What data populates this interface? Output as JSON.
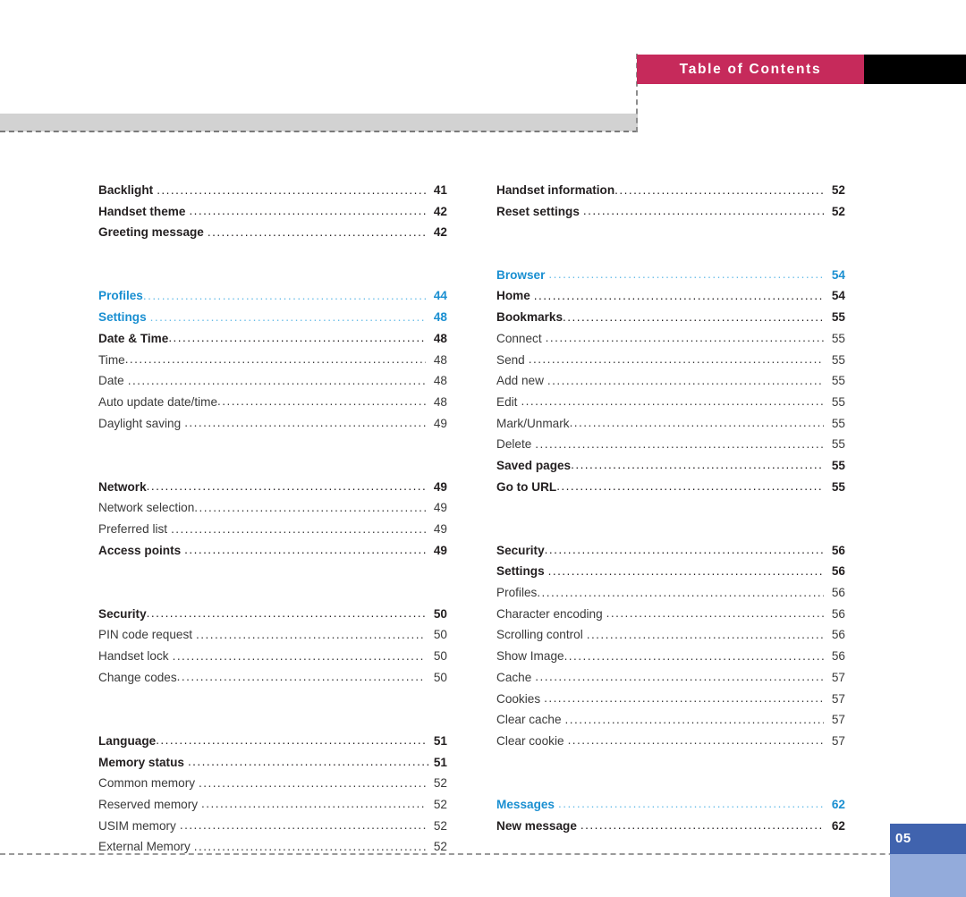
{
  "header": {
    "title": "Table of Contents",
    "pink_color": "#c62a5b",
    "black_color": "#000000"
  },
  "page_footer": {
    "page_number": "05",
    "dark_color": "#4063ae",
    "light_color": "#93abdb"
  },
  "colors": {
    "section_blue": "#1a8fd1",
    "body_black": "#231f20",
    "gray_bar": "#d2d2d2"
  },
  "toc": {
    "left_column": [
      {
        "label": "Backlight",
        "page": "41",
        "level": "bold",
        "gap": "small",
        "tail": "small"
      },
      {
        "label": "Handset theme",
        "page": "42",
        "level": "bold",
        "gap": "small",
        "tail": "small"
      },
      {
        "label": "Greeting message",
        "page": "42",
        "level": "bold",
        "gap": "small",
        "tail": "small"
      },
      {
        "label": "",
        "page": "",
        "level": "spacer",
        "gap": "none",
        "tail": "none"
      },
      {
        "label": "",
        "page": "",
        "level": "spacer",
        "gap": "none",
        "tail": "none"
      },
      {
        "label": "Profiles",
        "page": "44",
        "level": "section",
        "gap": "none",
        "tail": "small"
      },
      {
        "label": "Settings",
        "page": "48",
        "level": "section",
        "gap": "small",
        "tail": "small"
      },
      {
        "label": "Date & Time",
        "page": "48",
        "level": "bold",
        "gap": "none",
        "tail": "small"
      },
      {
        "label": "Time",
        "page": "48",
        "level": "plain",
        "gap": "none",
        "tail": "small"
      },
      {
        "label": "Date",
        "page": "48",
        "level": "plain",
        "gap": "small",
        "tail": "small"
      },
      {
        "label": "Auto update date/time",
        "page": "48",
        "level": "plain",
        "gap": "none",
        "tail": "small"
      },
      {
        "label": "Daylight saving",
        "page": "49",
        "level": "plain",
        "gap": "small",
        "tail": "small"
      },
      {
        "label": "",
        "page": "",
        "level": "spacer",
        "gap": "none",
        "tail": "none"
      },
      {
        "label": "",
        "page": "",
        "level": "spacer",
        "gap": "none",
        "tail": "none"
      },
      {
        "label": "Network",
        "page": "49",
        "level": "bold",
        "gap": "none",
        "tail": "small"
      },
      {
        "label": "Network selection",
        "page": "49",
        "level": "plain",
        "gap": "none",
        "tail": "small"
      },
      {
        "label": "Preferred list",
        "page": "49",
        "level": "plain",
        "gap": "small",
        "tail": "small"
      },
      {
        "label": "Access points",
        "page": "49",
        "level": "bold",
        "gap": "small",
        "tail": "small"
      },
      {
        "label": "",
        "page": "",
        "level": "spacer",
        "gap": "none",
        "tail": "none"
      },
      {
        "label": "",
        "page": "",
        "level": "spacer",
        "gap": "none",
        "tail": "none"
      },
      {
        "label": "Security",
        "page": "50",
        "level": "bold",
        "gap": "none",
        "tail": "small"
      },
      {
        "label": "PIN code request",
        "page": "50",
        "level": "plain",
        "gap": "small",
        "tail": "small"
      },
      {
        "label": "Handset lock",
        "page": "50",
        "level": "plain",
        "gap": "small",
        "tail": "small"
      },
      {
        "label": "Change codes",
        "page": "50",
        "level": "plain",
        "gap": "none",
        "tail": "small"
      },
      {
        "label": "",
        "page": "",
        "level": "spacer",
        "gap": "none",
        "tail": "none"
      },
      {
        "label": "",
        "page": "",
        "level": "spacer",
        "gap": "none",
        "tail": "none"
      },
      {
        "label": "Language",
        "page": "51",
        "level": "bold",
        "gap": "none",
        "tail": "small"
      },
      {
        "label": "Memory status",
        "page": "51",
        "level": "bold",
        "gap": "small",
        "tail": "none"
      },
      {
        "label": "Common memory",
        "page": "52",
        "level": "plain",
        "gap": "small",
        "tail": "small"
      },
      {
        "label": "Reserved memory",
        "page": "52",
        "level": "plain",
        "gap": "small",
        "tail": "small"
      },
      {
        "label": "USIM memory",
        "page": "52",
        "level": "plain",
        "gap": "small",
        "tail": "small"
      },
      {
        "label": "External Memory",
        "page": "52",
        "level": "plain",
        "gap": "small",
        "tail": "small"
      }
    ],
    "right_column": [
      {
        "label": "Handset information",
        "page": "52",
        "level": "bold",
        "gap": "none",
        "tail": "small"
      },
      {
        "label": "Reset settings",
        "page": "52",
        "level": "bold",
        "gap": "small",
        "tail": "small"
      },
      {
        "label": "",
        "page": "",
        "level": "spacer",
        "gap": "none",
        "tail": "none"
      },
      {
        "label": "",
        "page": "",
        "level": "spacer",
        "gap": "none",
        "tail": "none"
      },
      {
        "label": "Browser",
        "page": "54",
        "level": "section",
        "gap": "small",
        "tail": "small"
      },
      {
        "label": "Home",
        "page": "54",
        "level": "bold",
        "gap": "small",
        "tail": "small"
      },
      {
        "label": "Bookmarks",
        "page": "55",
        "level": "bold",
        "gap": "none",
        "tail": "small"
      },
      {
        "label": "Connect",
        "page": "55",
        "level": "plain",
        "gap": "small",
        "tail": "small"
      },
      {
        "label": "Send",
        "page": "55",
        "level": "plain",
        "gap": "small",
        "tail": "small"
      },
      {
        "label": "Add new",
        "page": "55",
        "level": "plain",
        "gap": "small",
        "tail": "small"
      },
      {
        "label": "Edit",
        "page": "55",
        "level": "plain",
        "gap": "small",
        "tail": "small"
      },
      {
        "label": "Mark/Unmark",
        "page": "55",
        "level": "plain",
        "gap": "none",
        "tail": "small"
      },
      {
        "label": "Delete",
        "page": "55",
        "level": "plain",
        "gap": "small",
        "tail": "small"
      },
      {
        "label": "Saved pages",
        "page": "55",
        "level": "bold",
        "gap": "none",
        "tail": "small"
      },
      {
        "label": "Go to URL",
        "page": "55",
        "level": "bold",
        "gap": "none",
        "tail": "small"
      },
      {
        "label": "",
        "page": "",
        "level": "spacer",
        "gap": "none",
        "tail": "none"
      },
      {
        "label": "",
        "page": "",
        "level": "spacer",
        "gap": "none",
        "tail": "none"
      },
      {
        "label": "Security",
        "page": "56",
        "level": "bold",
        "gap": "none",
        "tail": "small"
      },
      {
        "label": "Settings",
        "page": "56",
        "level": "bold",
        "gap": "small",
        "tail": "small"
      },
      {
        "label": "Profiles",
        "page": "56",
        "level": "plain",
        "gap": "none",
        "tail": "small"
      },
      {
        "label": "Character encoding",
        "page": "56",
        "level": "plain",
        "gap": "small",
        "tail": "small"
      },
      {
        "label": "Scrolling control",
        "page": "56",
        "level": "plain",
        "gap": "small",
        "tail": "small"
      },
      {
        "label": "Show Image",
        "page": "56",
        "level": "plain",
        "gap": "none",
        "tail": "small"
      },
      {
        "label": "Cache",
        "page": "57",
        "level": "plain",
        "gap": "small",
        "tail": "small"
      },
      {
        "label": "Cookies",
        "page": "57",
        "level": "plain",
        "gap": "small",
        "tail": "small"
      },
      {
        "label": "Clear cache",
        "page": "57",
        "level": "plain",
        "gap": "small",
        "tail": "small"
      },
      {
        "label": "Clear cookie",
        "page": "57",
        "level": "plain",
        "gap": "small",
        "tail": "small"
      },
      {
        "label": "",
        "page": "",
        "level": "spacer",
        "gap": "none",
        "tail": "none"
      },
      {
        "label": "",
        "page": "",
        "level": "spacer",
        "gap": "none",
        "tail": "none"
      },
      {
        "label": "Messages",
        "page": "62",
        "level": "section",
        "gap": "small",
        "tail": "small"
      },
      {
        "label": "New message",
        "page": "62",
        "level": "bold",
        "gap": "small",
        "tail": "small"
      }
    ]
  }
}
